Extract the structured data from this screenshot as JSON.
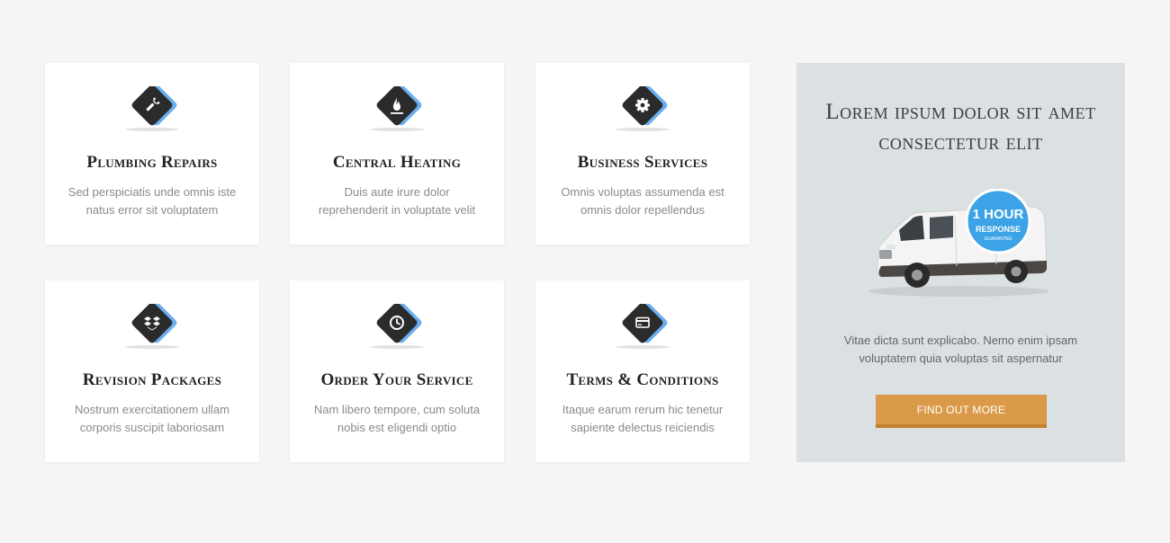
{
  "services": [
    {
      "title": "Plumbing Repairs",
      "description": "Sed perspiciatis unde omnis iste natus error sit voluptatem",
      "icon": "wrench-icon"
    },
    {
      "title": "Central Heating",
      "description": "Duis aute irure dolor reprehenderit in voluptate velit",
      "icon": "flame-icon"
    },
    {
      "title": "Business Services",
      "description": "Omnis voluptas assumenda est omnis dolor repellendus",
      "icon": "gear-icon"
    },
    {
      "title": "Revision Packages",
      "description": "Nostrum exercitationem ullam corporis suscipit laboriosam",
      "icon": "dropbox-icon"
    },
    {
      "title": "Order Your Service",
      "description": "Nam libero tempore, cum soluta nobis est eligendi optio",
      "icon": "clock-icon"
    },
    {
      "title": "Terms & Conditions",
      "description": "Itaque earum rerum hic tenetur sapiente delectus reiciendis",
      "icon": "credit-card-icon"
    }
  ],
  "promo": {
    "title": "Lorem ipsum dolor sit amet consectetur elit",
    "badge": {
      "line1": "1 HOUR",
      "line2": "RESPONSE",
      "line3": "GUARANTEE"
    },
    "description": "Vitae dicta sunt explicabo. Nemo enim ipsam voluptatem quia voluptas sit aspernatur",
    "button_label": "Find out more"
  },
  "colors": {
    "icon_dark": "#2b2b2b",
    "icon_accent": "#6aaef0",
    "button": "#da9a4a",
    "promo_bg": "#dbe0e2",
    "badge": "#3ba3e6"
  }
}
